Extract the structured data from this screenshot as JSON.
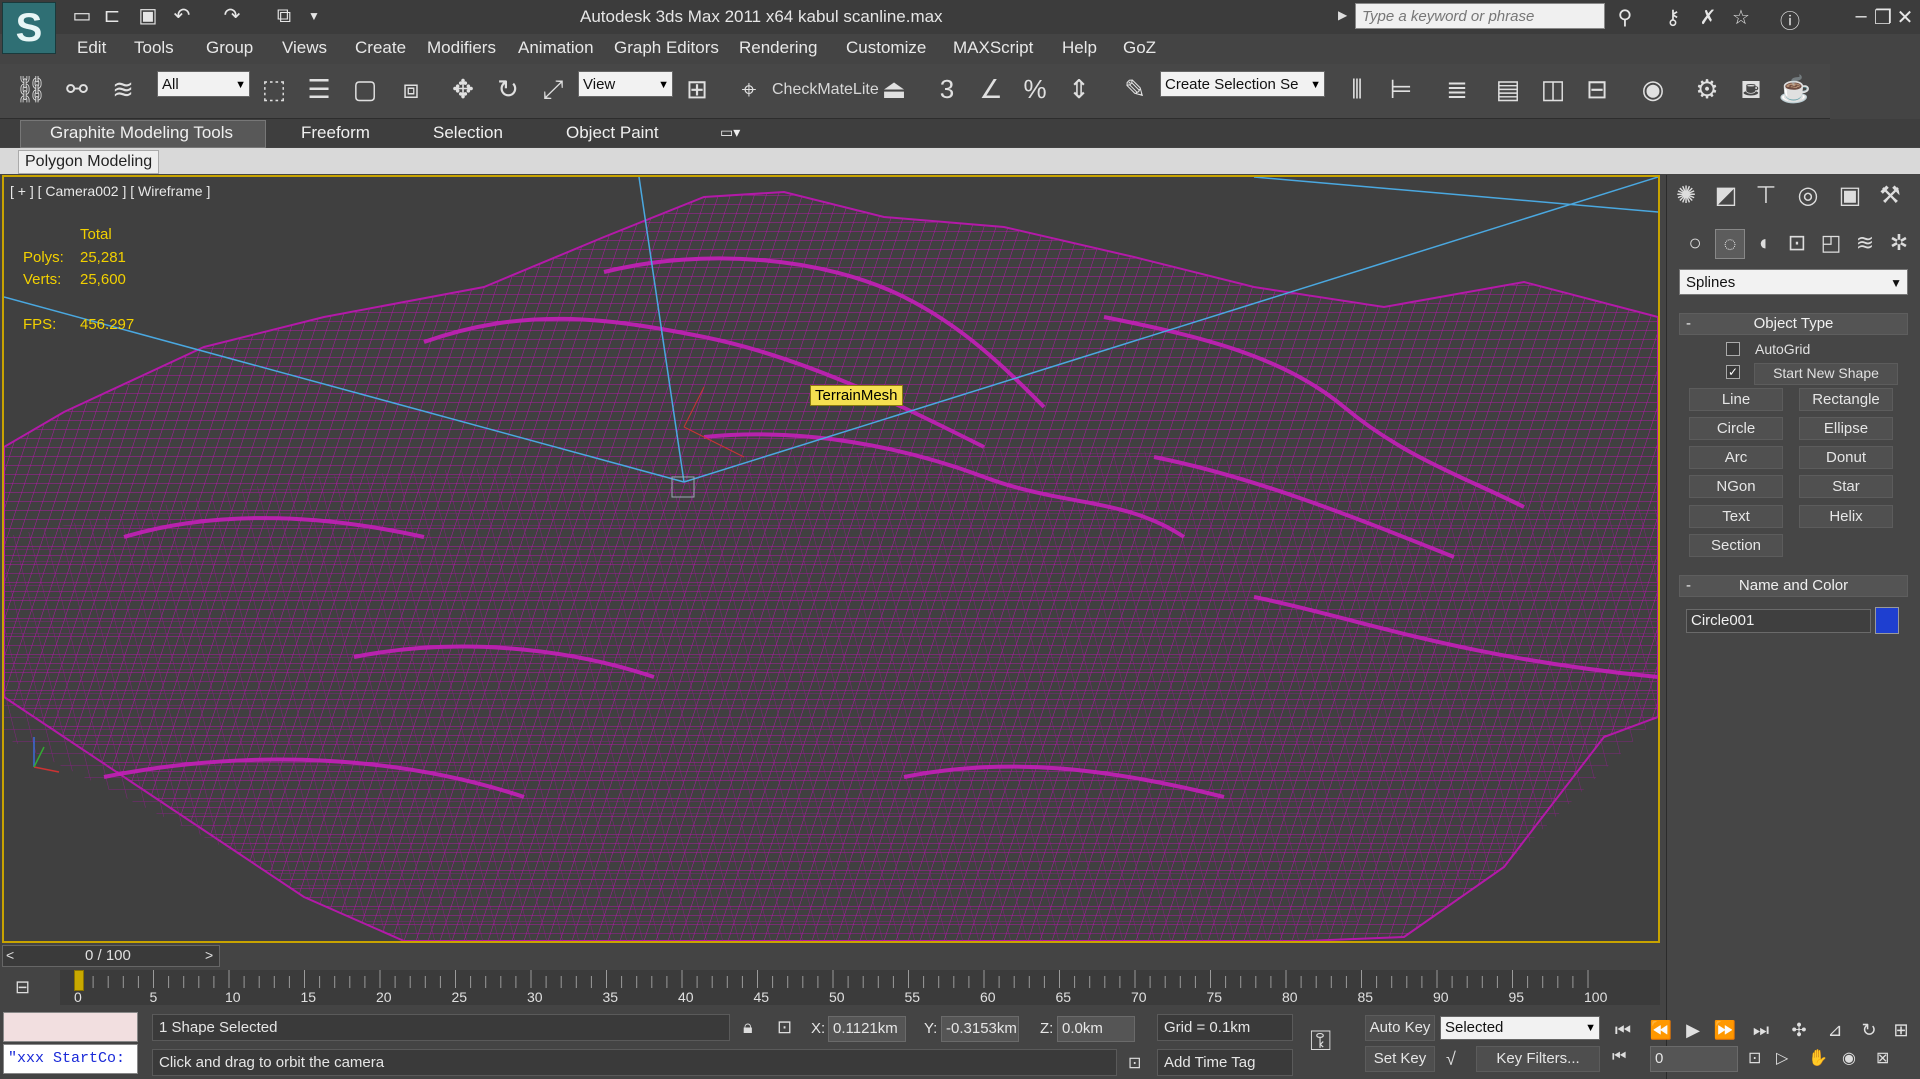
{
  "title_bar": {
    "window_title": "Autodesk 3ds Max  2011 x64       kabul scanline.max",
    "search_placeholder": "Type a keyword or phrase"
  },
  "menu": [
    "Edit",
    "Tools",
    "Group",
    "Views",
    "Create",
    "Modifiers",
    "Animation",
    "Graph Editors",
    "Rendering",
    "Customize",
    "MAXScript",
    "Help",
    "GoZ"
  ],
  "toolbar": {
    "selection_filter": "All",
    "reference_coord": "View",
    "checkmate_label": "CheckMateLite",
    "named_selection": "Create Selection Se"
  },
  "ribbon": {
    "tabs": [
      "Graphite Modeling Tools",
      "Freeform",
      "Selection",
      "Object Paint"
    ],
    "active_tab": "Graphite Modeling Tools",
    "panel_label": "Polygon Modeling"
  },
  "viewport": {
    "label": "[ + ] [ Camera002 ] [ Wireframe ]",
    "stats": {
      "header": "Total",
      "polys_label": "Polys:",
      "polys_value": "25,281",
      "verts_label": "Verts:",
      "verts_value": "25,600",
      "fps_label": "FPS:",
      "fps_value": "456.297"
    },
    "tooltip": "TerrainMesh",
    "wire_color": "#b319a8",
    "border_color": "#c8a300"
  },
  "command_panel": {
    "category": "Splines",
    "object_type": {
      "title": "Object Type",
      "autogrid": "AutoGrid",
      "start_new_shape": "Start New Shape",
      "buttons": [
        "Line",
        "Rectangle",
        "Circle",
        "Ellipse",
        "Arc",
        "Donut",
        "NGon",
        "Star",
        "Text",
        "Helix",
        "Section"
      ]
    },
    "name_color": {
      "title": "Name and Color",
      "name": "Circle001",
      "color": "#1e3fd0"
    }
  },
  "timeline": {
    "slider_label": "0 / 100",
    "ticks": [
      "0",
      "5",
      "10",
      "15",
      "20",
      "25",
      "30",
      "35",
      "40",
      "45",
      "50",
      "55",
      "60",
      "65",
      "70",
      "75",
      "80",
      "85",
      "90",
      "95",
      "100"
    ]
  },
  "status": {
    "maxscript_text": "\"xxx StartCo:",
    "selection": "1 Shape Selected",
    "prompt": "Click and drag to orbit the camera",
    "x_label": "X:",
    "x_value": "0.1121km",
    "y_label": "Y:",
    "y_value": "-0.3153km",
    "z_label": "Z:",
    "z_value": "0.0km",
    "grid": "Grid = 0.1km",
    "add_time_tag": "Add Time Tag",
    "auto_key": "Auto Key",
    "set_key": "Set Key",
    "key_mode": "Selected",
    "key_filters": "Key Filters...",
    "frame_value": "0"
  }
}
